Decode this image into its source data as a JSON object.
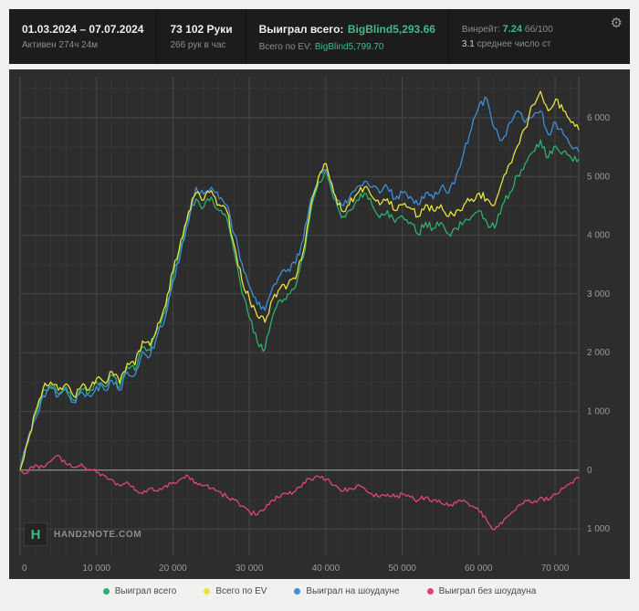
{
  "header": {
    "date_range": "01.03.2024 – 07.07.2024",
    "active_time": "Активен 274ч 24м",
    "hands": "73 102 Руки",
    "hands_per_hour": "266 рук в час",
    "won_total_label": "Выиграл всего:",
    "won_total_value": "BigBlind5,293.66",
    "ev_total_label": "Всего по EV:",
    "ev_total_value": "BigBlind5,799.70",
    "winrate_label": "Винрейт:",
    "winrate_value": "7.24",
    "winrate_unit": "бб/100",
    "avg_value": "3.1",
    "avg_label": "среднее число ст",
    "gear_icon": "⚙"
  },
  "logo": {
    "badge": "H",
    "text": "HAND2NOTE.COM"
  },
  "chart_data": {
    "type": "line",
    "xlabel": "hands",
    "ylabel": "BigBlinds won",
    "xmax": 73102,
    "ylim": [
      -1450,
      6700
    ],
    "grid": true,
    "legend_position": "bottom",
    "x_ticks": [
      {
        "v": 0,
        "label": "0"
      },
      {
        "v": 10000,
        "label": "10 000"
      },
      {
        "v": 20000,
        "label": "20 000"
      },
      {
        "v": 30000,
        "label": "30 000"
      },
      {
        "v": 40000,
        "label": "40 000"
      },
      {
        "v": 50000,
        "label": "50 000"
      },
      {
        "v": 60000,
        "label": "60 000"
      },
      {
        "v": 70000,
        "label": "70 000"
      }
    ],
    "y_ticks": [
      {
        "v": 6000,
        "label": "6 000"
      },
      {
        "v": 5000,
        "label": "5 000"
      },
      {
        "v": 4000,
        "label": "4 000"
      },
      {
        "v": 3000,
        "label": "3 000"
      },
      {
        "v": 2000,
        "label": "2 000"
      },
      {
        "v": 1000,
        "label": "1 000"
      },
      {
        "v": 0,
        "label": "0"
      },
      {
        "v": -1000,
        "label": "1 000"
      }
    ],
    "series": [
      {
        "name": "Выиграл всего",
        "color": "#2eb06d",
        "final_value": 5293.66,
        "values": [
          0,
          500,
          950,
          1350,
          1450,
          1300,
          1420,
          1200,
          1380,
          1320,
          1500,
          1430,
          1620,
          1400,
          1760,
          1700,
          2100,
          2040,
          2420,
          2700,
          3300,
          3820,
          4300,
          4620,
          4480,
          4650,
          4420,
          4300,
          3700,
          3020,
          2580,
          2180,
          2060,
          2620,
          2900,
          3000,
          3120,
          3620,
          4420,
          4900,
          5120,
          4620,
          4300,
          4420,
          4600,
          4720,
          4520,
          4300,
          4420,
          4220,
          4320,
          4220,
          4020,
          4220,
          4120,
          4220,
          4020,
          4120,
          4220,
          4320,
          4420,
          4220,
          4120,
          4520,
          4720,
          5020,
          5220,
          5420,
          5620,
          5320,
          5520,
          5420,
          5320,
          5294
        ]
      },
      {
        "name": "Выиграл на шоудауне",
        "color": "#3e8fd8",
        "final_value": 5424,
        "values": [
          0,
          540,
          870,
          1270,
          1400,
          1260,
          1370,
          1160,
          1330,
          1270,
          1430,
          1370,
          1530,
          1360,
          1670,
          1620,
          2020,
          1940,
          2320,
          2620,
          3220,
          3720,
          4220,
          4820,
          4700,
          4820,
          4620,
          4520,
          4020,
          3520,
          3120,
          2820,
          2720,
          3120,
          3320,
          3420,
          3520,
          3920,
          4620,
          5000,
          5120,
          4720,
          4520,
          4620,
          4820,
          4920,
          4820,
          4720,
          4820,
          4620,
          4720,
          4660,
          4520,
          4720,
          4620,
          4820,
          4720,
          5020,
          5420,
          5820,
          6220,
          6320,
          5820,
          5620,
          5920,
          6120,
          5920,
          6020,
          6120,
          5720,
          5920,
          5720,
          5520,
          5424
        ]
      },
      {
        "name": "Всего по EV",
        "color": "#e8e23c",
        "final_value": 5799.7,
        "values": [
          0,
          470,
          990,
          1390,
          1500,
          1360,
          1470,
          1260,
          1430,
          1370,
          1560,
          1500,
          1680,
          1480,
          1820,
          1790,
          2200,
          2120,
          2500,
          2800,
          3400,
          3920,
          4400,
          4720,
          4600,
          4760,
          4520,
          4420,
          3820,
          3220,
          2900,
          2620,
          2520,
          2920,
          3100,
          3160,
          3260,
          3720,
          4520,
          5000,
          5220,
          4720,
          4420,
          4520,
          4700,
          4820,
          4660,
          4520,
          4620,
          4420,
          4520,
          4460,
          4320,
          4520,
          4420,
          4520,
          4320,
          4420,
          4520,
          4620,
          4720,
          4620,
          4520,
          4920,
          5220,
          5520,
          5820,
          6220,
          6450,
          6120,
          6320,
          6120,
          5920,
          5800
        ]
      },
      {
        "name": "Выиграл без шоудауна",
        "color": "#e0447c",
        "final_value": -130,
        "values": [
          0,
          -40,
          90,
          50,
          150,
          250,
          100,
          50,
          110,
          10,
          -40,
          -90,
          -160,
          -260,
          -200,
          -350,
          -400,
          -310,
          -360,
          -260,
          -210,
          -150,
          -110,
          -210,
          -260,
          -310,
          -360,
          -460,
          -510,
          -610,
          -710,
          -760,
          -660,
          -510,
          -460,
          -410,
          -360,
          -210,
          -160,
          -110,
          -160,
          -260,
          -360,
          -310,
          -260,
          -310,
          -410,
          -460,
          -410,
          -460,
          -410,
          -460,
          -510,
          -460,
          -510,
          -560,
          -610,
          -560,
          -510,
          -610,
          -710,
          -860,
          -1010,
          -910,
          -760,
          -610,
          -510,
          -560,
          -460,
          -510,
          -410,
          -310,
          -210,
          -130
        ]
      }
    ],
    "legend_order": [
      0,
      2,
      1,
      3
    ]
  }
}
